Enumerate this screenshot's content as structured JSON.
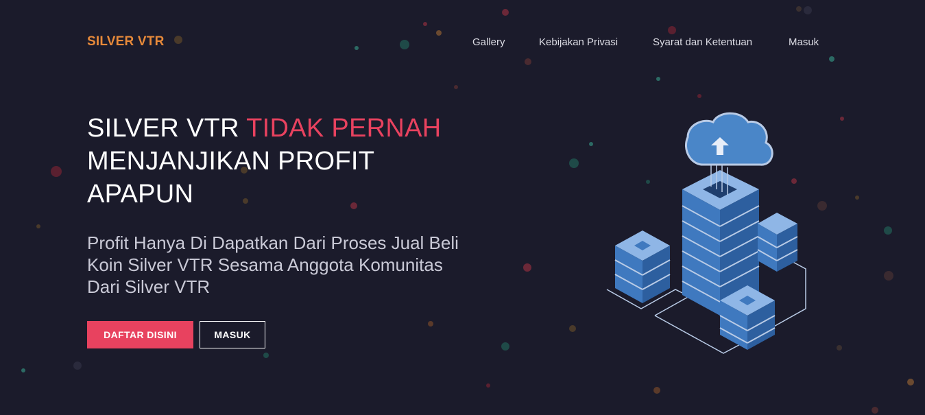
{
  "navbar": {
    "brand": "SILVER VTR",
    "links": [
      {
        "label": "Gallery"
      },
      {
        "label": "Kebijakan Privasi"
      },
      {
        "label": "Syarat dan Ketentuan"
      },
      {
        "label": "Masuk"
      }
    ]
  },
  "hero": {
    "title_part1": "SILVER VTR ",
    "title_accent": "TIDAK PERNAH",
    "title_part2": "MENJANJIKAN PROFIT APAPUN",
    "subtitle": "Profit Hanya Di Dapatkan Dari Proses Jual Beli Koin Silver VTR Sesama Anggota Komunitas Dari Silver VTR",
    "primary_button": "DAFTAR DISINI",
    "secondary_button": "MASUK"
  },
  "illustration": {
    "icon": "cloud-server-icon"
  },
  "colors": {
    "background": "#1b1b2b",
    "brand": "#e88a3a",
    "accent": "#e8425f",
    "server_blue": "#4a86c8"
  }
}
